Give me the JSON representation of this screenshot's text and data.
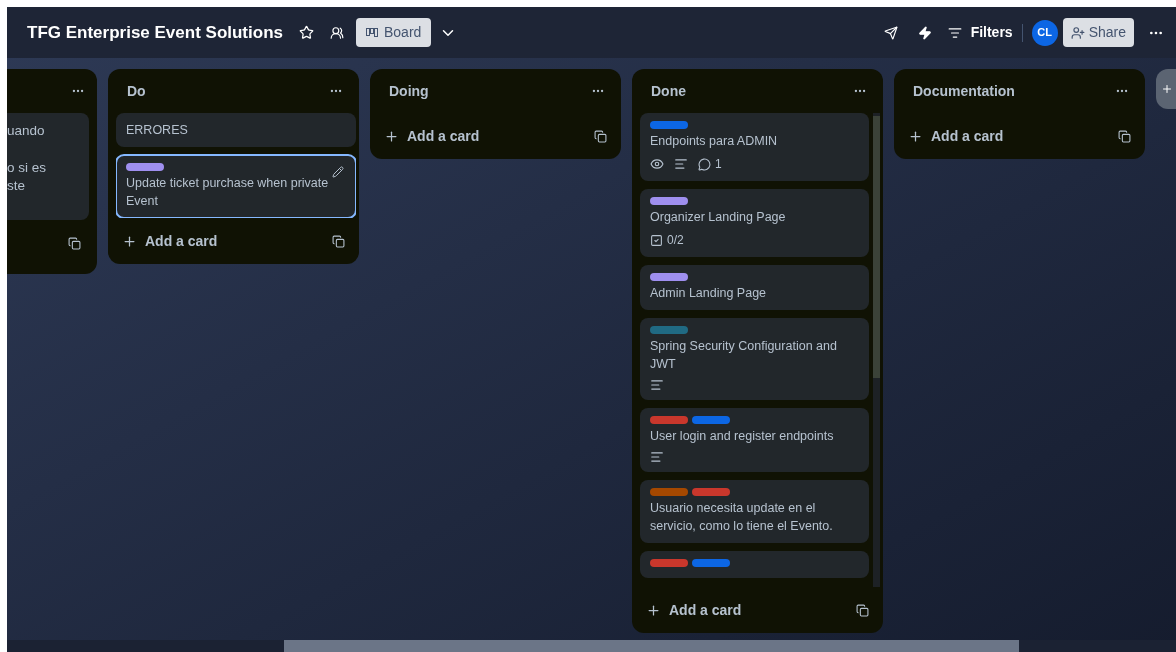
{
  "header": {
    "title": "TFG Enterprise Event Solutions",
    "view_button": "Board",
    "filters": "Filters",
    "avatar": "CL",
    "share": "Share"
  },
  "lists": [
    {
      "kind": "partial",
      "cards": [
        {
          "text_fragments": [
            "uando",
            "o si es",
            "ste"
          ]
        }
      ]
    },
    {
      "kind": "full",
      "title": "Do",
      "add_card": "Add a card",
      "cards": [
        {
          "title": "ERRORES",
          "focused": false
        },
        {
          "title": "Update ticket purchase when private Event",
          "labels": [
            {
              "color": "#9f8fef"
            }
          ],
          "focused": true
        }
      ]
    },
    {
      "kind": "full",
      "title": "Doing",
      "add_card": "Add a card"
    },
    {
      "kind": "full",
      "scroll": true,
      "title": "Done",
      "add_card": "Add a card",
      "cards": [
        {
          "title": "Endpoints para ADMIN",
          "labels": [
            {
              "color": "#0c66e4"
            }
          ],
          "badges": [
            {
              "kind": "watch"
            },
            {
              "kind": "description"
            },
            {
              "kind": "comments",
              "text": "1"
            }
          ],
          "focused": false
        },
        {
          "title": "Organizer Landing Page",
          "labels": [
            {
              "color": "#9f8fef"
            }
          ],
          "badges": [
            {
              "kind": "checklist",
              "text": "0/2"
            }
          ],
          "focused": false
        },
        {
          "title": "Admin Landing Page",
          "labels": [
            {
              "color": "#9f8fef"
            }
          ],
          "focused": false
        },
        {
          "title": "Spring Security Configuration and JWT",
          "labels": [
            {
              "color": "#206a83"
            }
          ],
          "badges": [
            {
              "kind": "description"
            }
          ],
          "focused": false
        },
        {
          "title": "User login and register endpoints",
          "labels": [
            {
              "color": "#c9372c"
            },
            {
              "color": "#0c66e4"
            }
          ],
          "badges": [
            {
              "kind": "description"
            }
          ],
          "focused": false
        },
        {
          "title": "Usuario necesita update en el servicio, como lo tiene el Evento.",
          "labels": [
            {
              "color": "#a54800"
            },
            {
              "color": "#c9372c"
            }
          ],
          "focused": false
        },
        {
          "labels": [
            {
              "color": "#c9372c"
            },
            {
              "color": "#0c66e4"
            }
          ],
          "focused": false
        }
      ]
    },
    {
      "kind": "full",
      "title": "Documentation",
      "add_card": "Add a card"
    }
  ]
}
